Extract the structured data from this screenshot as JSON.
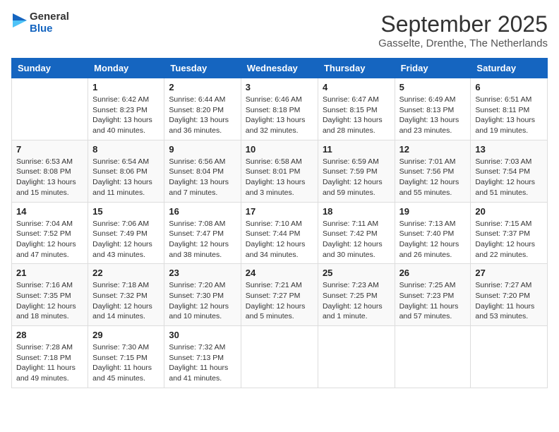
{
  "logo": {
    "general": "General",
    "blue": "Blue"
  },
  "header": {
    "month": "September 2025",
    "location": "Gasselte, Drenthe, The Netherlands"
  },
  "weekdays": [
    "Sunday",
    "Monday",
    "Tuesday",
    "Wednesday",
    "Thursday",
    "Friday",
    "Saturday"
  ],
  "weeks": [
    [
      {
        "day": "",
        "info": ""
      },
      {
        "day": "1",
        "info": "Sunrise: 6:42 AM\nSunset: 8:23 PM\nDaylight: 13 hours\nand 40 minutes."
      },
      {
        "day": "2",
        "info": "Sunrise: 6:44 AM\nSunset: 8:20 PM\nDaylight: 13 hours\nand 36 minutes."
      },
      {
        "day": "3",
        "info": "Sunrise: 6:46 AM\nSunset: 8:18 PM\nDaylight: 13 hours\nand 32 minutes."
      },
      {
        "day": "4",
        "info": "Sunrise: 6:47 AM\nSunset: 8:15 PM\nDaylight: 13 hours\nand 28 minutes."
      },
      {
        "day": "5",
        "info": "Sunrise: 6:49 AM\nSunset: 8:13 PM\nDaylight: 13 hours\nand 23 minutes."
      },
      {
        "day": "6",
        "info": "Sunrise: 6:51 AM\nSunset: 8:11 PM\nDaylight: 13 hours\nand 19 minutes."
      }
    ],
    [
      {
        "day": "7",
        "info": "Sunrise: 6:53 AM\nSunset: 8:08 PM\nDaylight: 13 hours\nand 15 minutes."
      },
      {
        "day": "8",
        "info": "Sunrise: 6:54 AM\nSunset: 8:06 PM\nDaylight: 13 hours\nand 11 minutes."
      },
      {
        "day": "9",
        "info": "Sunrise: 6:56 AM\nSunset: 8:04 PM\nDaylight: 13 hours\nand 7 minutes."
      },
      {
        "day": "10",
        "info": "Sunrise: 6:58 AM\nSunset: 8:01 PM\nDaylight: 13 hours\nand 3 minutes."
      },
      {
        "day": "11",
        "info": "Sunrise: 6:59 AM\nSunset: 7:59 PM\nDaylight: 12 hours\nand 59 minutes."
      },
      {
        "day": "12",
        "info": "Sunrise: 7:01 AM\nSunset: 7:56 PM\nDaylight: 12 hours\nand 55 minutes."
      },
      {
        "day": "13",
        "info": "Sunrise: 7:03 AM\nSunset: 7:54 PM\nDaylight: 12 hours\nand 51 minutes."
      }
    ],
    [
      {
        "day": "14",
        "info": "Sunrise: 7:04 AM\nSunset: 7:52 PM\nDaylight: 12 hours\nand 47 minutes."
      },
      {
        "day": "15",
        "info": "Sunrise: 7:06 AM\nSunset: 7:49 PM\nDaylight: 12 hours\nand 43 minutes."
      },
      {
        "day": "16",
        "info": "Sunrise: 7:08 AM\nSunset: 7:47 PM\nDaylight: 12 hours\nand 38 minutes."
      },
      {
        "day": "17",
        "info": "Sunrise: 7:10 AM\nSunset: 7:44 PM\nDaylight: 12 hours\nand 34 minutes."
      },
      {
        "day": "18",
        "info": "Sunrise: 7:11 AM\nSunset: 7:42 PM\nDaylight: 12 hours\nand 30 minutes."
      },
      {
        "day": "19",
        "info": "Sunrise: 7:13 AM\nSunset: 7:40 PM\nDaylight: 12 hours\nand 26 minutes."
      },
      {
        "day": "20",
        "info": "Sunrise: 7:15 AM\nSunset: 7:37 PM\nDaylight: 12 hours\nand 22 minutes."
      }
    ],
    [
      {
        "day": "21",
        "info": "Sunrise: 7:16 AM\nSunset: 7:35 PM\nDaylight: 12 hours\nand 18 minutes."
      },
      {
        "day": "22",
        "info": "Sunrise: 7:18 AM\nSunset: 7:32 PM\nDaylight: 12 hours\nand 14 minutes."
      },
      {
        "day": "23",
        "info": "Sunrise: 7:20 AM\nSunset: 7:30 PM\nDaylight: 12 hours\nand 10 minutes."
      },
      {
        "day": "24",
        "info": "Sunrise: 7:21 AM\nSunset: 7:27 PM\nDaylight: 12 hours\nand 5 minutes."
      },
      {
        "day": "25",
        "info": "Sunrise: 7:23 AM\nSunset: 7:25 PM\nDaylight: 12 hours\nand 1 minute."
      },
      {
        "day": "26",
        "info": "Sunrise: 7:25 AM\nSunset: 7:23 PM\nDaylight: 11 hours\nand 57 minutes."
      },
      {
        "day": "27",
        "info": "Sunrise: 7:27 AM\nSunset: 7:20 PM\nDaylight: 11 hours\nand 53 minutes."
      }
    ],
    [
      {
        "day": "28",
        "info": "Sunrise: 7:28 AM\nSunset: 7:18 PM\nDaylight: 11 hours\nand 49 minutes."
      },
      {
        "day": "29",
        "info": "Sunrise: 7:30 AM\nSunset: 7:15 PM\nDaylight: 11 hours\nand 45 minutes."
      },
      {
        "day": "30",
        "info": "Sunrise: 7:32 AM\nSunset: 7:13 PM\nDaylight: 11 hours\nand 41 minutes."
      },
      {
        "day": "",
        "info": ""
      },
      {
        "day": "",
        "info": ""
      },
      {
        "day": "",
        "info": ""
      },
      {
        "day": "",
        "info": ""
      }
    ]
  ]
}
